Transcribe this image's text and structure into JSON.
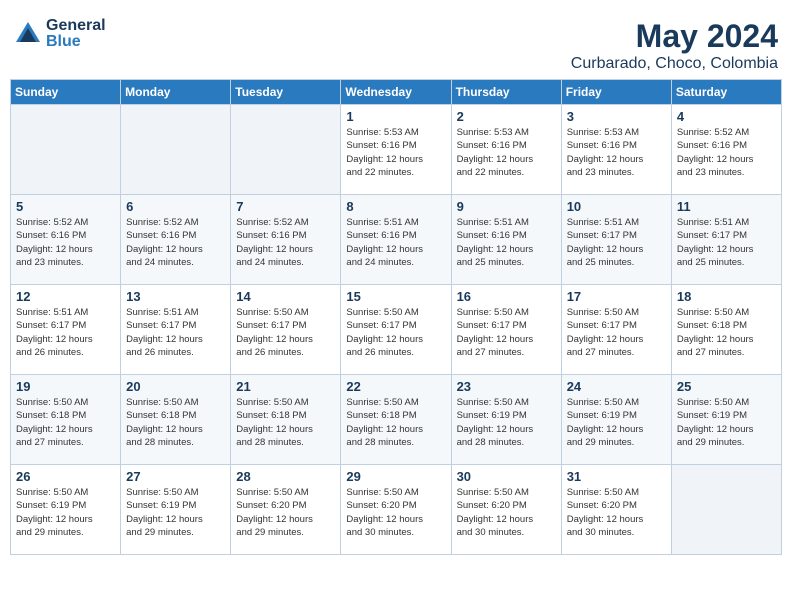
{
  "logo": {
    "general": "General",
    "blue": "Blue"
  },
  "header": {
    "title": "May 2024",
    "subtitle": "Curbarado, Choco, Colombia"
  },
  "weekdays": [
    "Sunday",
    "Monday",
    "Tuesday",
    "Wednesday",
    "Thursday",
    "Friday",
    "Saturday"
  ],
  "weeks": [
    [
      {
        "day": "",
        "info": ""
      },
      {
        "day": "",
        "info": ""
      },
      {
        "day": "",
        "info": ""
      },
      {
        "day": "1",
        "info": "Sunrise: 5:53 AM\nSunset: 6:16 PM\nDaylight: 12 hours\nand 22 minutes."
      },
      {
        "day": "2",
        "info": "Sunrise: 5:53 AM\nSunset: 6:16 PM\nDaylight: 12 hours\nand 22 minutes."
      },
      {
        "day": "3",
        "info": "Sunrise: 5:53 AM\nSunset: 6:16 PM\nDaylight: 12 hours\nand 23 minutes."
      },
      {
        "day": "4",
        "info": "Sunrise: 5:52 AM\nSunset: 6:16 PM\nDaylight: 12 hours\nand 23 minutes."
      }
    ],
    [
      {
        "day": "5",
        "info": "Sunrise: 5:52 AM\nSunset: 6:16 PM\nDaylight: 12 hours\nand 23 minutes."
      },
      {
        "day": "6",
        "info": "Sunrise: 5:52 AM\nSunset: 6:16 PM\nDaylight: 12 hours\nand 24 minutes."
      },
      {
        "day": "7",
        "info": "Sunrise: 5:52 AM\nSunset: 6:16 PM\nDaylight: 12 hours\nand 24 minutes."
      },
      {
        "day": "8",
        "info": "Sunrise: 5:51 AM\nSunset: 6:16 PM\nDaylight: 12 hours\nand 24 minutes."
      },
      {
        "day": "9",
        "info": "Sunrise: 5:51 AM\nSunset: 6:16 PM\nDaylight: 12 hours\nand 25 minutes."
      },
      {
        "day": "10",
        "info": "Sunrise: 5:51 AM\nSunset: 6:17 PM\nDaylight: 12 hours\nand 25 minutes."
      },
      {
        "day": "11",
        "info": "Sunrise: 5:51 AM\nSunset: 6:17 PM\nDaylight: 12 hours\nand 25 minutes."
      }
    ],
    [
      {
        "day": "12",
        "info": "Sunrise: 5:51 AM\nSunset: 6:17 PM\nDaylight: 12 hours\nand 26 minutes."
      },
      {
        "day": "13",
        "info": "Sunrise: 5:51 AM\nSunset: 6:17 PM\nDaylight: 12 hours\nand 26 minutes."
      },
      {
        "day": "14",
        "info": "Sunrise: 5:50 AM\nSunset: 6:17 PM\nDaylight: 12 hours\nand 26 minutes."
      },
      {
        "day": "15",
        "info": "Sunrise: 5:50 AM\nSunset: 6:17 PM\nDaylight: 12 hours\nand 26 minutes."
      },
      {
        "day": "16",
        "info": "Sunrise: 5:50 AM\nSunset: 6:17 PM\nDaylight: 12 hours\nand 27 minutes."
      },
      {
        "day": "17",
        "info": "Sunrise: 5:50 AM\nSunset: 6:17 PM\nDaylight: 12 hours\nand 27 minutes."
      },
      {
        "day": "18",
        "info": "Sunrise: 5:50 AM\nSunset: 6:18 PM\nDaylight: 12 hours\nand 27 minutes."
      }
    ],
    [
      {
        "day": "19",
        "info": "Sunrise: 5:50 AM\nSunset: 6:18 PM\nDaylight: 12 hours\nand 27 minutes."
      },
      {
        "day": "20",
        "info": "Sunrise: 5:50 AM\nSunset: 6:18 PM\nDaylight: 12 hours\nand 28 minutes."
      },
      {
        "day": "21",
        "info": "Sunrise: 5:50 AM\nSunset: 6:18 PM\nDaylight: 12 hours\nand 28 minutes."
      },
      {
        "day": "22",
        "info": "Sunrise: 5:50 AM\nSunset: 6:18 PM\nDaylight: 12 hours\nand 28 minutes."
      },
      {
        "day": "23",
        "info": "Sunrise: 5:50 AM\nSunset: 6:19 PM\nDaylight: 12 hours\nand 28 minutes."
      },
      {
        "day": "24",
        "info": "Sunrise: 5:50 AM\nSunset: 6:19 PM\nDaylight: 12 hours\nand 29 minutes."
      },
      {
        "day": "25",
        "info": "Sunrise: 5:50 AM\nSunset: 6:19 PM\nDaylight: 12 hours\nand 29 minutes."
      }
    ],
    [
      {
        "day": "26",
        "info": "Sunrise: 5:50 AM\nSunset: 6:19 PM\nDaylight: 12 hours\nand 29 minutes."
      },
      {
        "day": "27",
        "info": "Sunrise: 5:50 AM\nSunset: 6:19 PM\nDaylight: 12 hours\nand 29 minutes."
      },
      {
        "day": "28",
        "info": "Sunrise: 5:50 AM\nSunset: 6:20 PM\nDaylight: 12 hours\nand 29 minutes."
      },
      {
        "day": "29",
        "info": "Sunrise: 5:50 AM\nSunset: 6:20 PM\nDaylight: 12 hours\nand 30 minutes."
      },
      {
        "day": "30",
        "info": "Sunrise: 5:50 AM\nSunset: 6:20 PM\nDaylight: 12 hours\nand 30 minutes."
      },
      {
        "day": "31",
        "info": "Sunrise: 5:50 AM\nSunset: 6:20 PM\nDaylight: 12 hours\nand 30 minutes."
      },
      {
        "day": "",
        "info": ""
      }
    ]
  ]
}
